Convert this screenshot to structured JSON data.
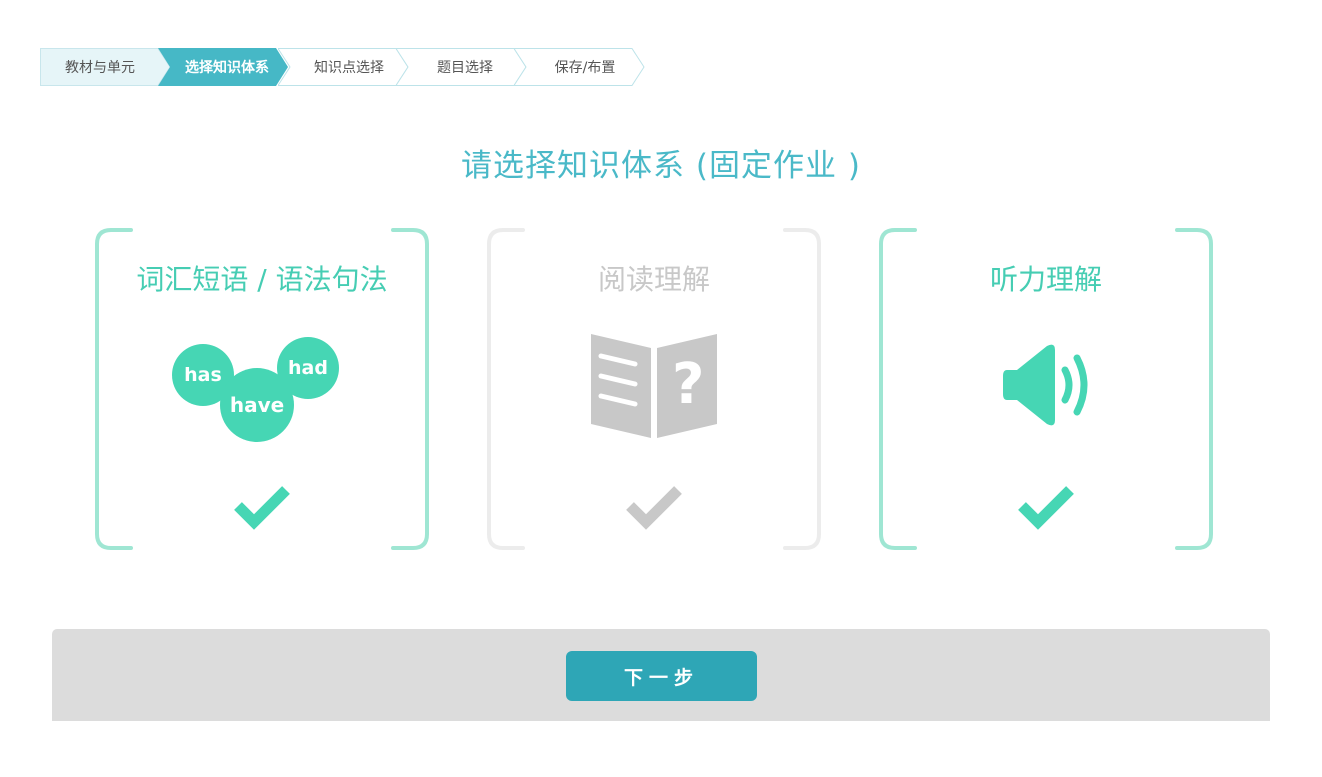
{
  "steps": [
    {
      "label": "教材与单元",
      "state": "done"
    },
    {
      "label": "选择知识体系",
      "state": "active"
    },
    {
      "label": "知识点选择",
      "state": "todo"
    },
    {
      "label": "题目选择",
      "state": "todo"
    },
    {
      "label": "保存/布置",
      "state": "todo"
    }
  ],
  "page_title": "请选择知识体系 (固定作业 )",
  "cards": [
    {
      "title": "词汇短语 / 语法句法",
      "state": "selected",
      "icon": "word-bubbles-icon",
      "bubbles": [
        "has",
        "have",
        "had"
      ]
    },
    {
      "title": "阅读理解",
      "state": "disabled",
      "icon": "book-question-icon",
      "glyph": "?"
    },
    {
      "title": "听力理解",
      "state": "selected",
      "icon": "speaker-icon"
    }
  ],
  "colors": {
    "accent": "#46d6b4",
    "accent_light": "#9fe6d3",
    "title_teal": "#4ab9c8",
    "active_step": "#46b8c6",
    "disabled": "#c8c8c8",
    "button": "#2ea6b6",
    "footer": "#dcdcdc"
  },
  "footer": {
    "next_label": "下一步"
  }
}
